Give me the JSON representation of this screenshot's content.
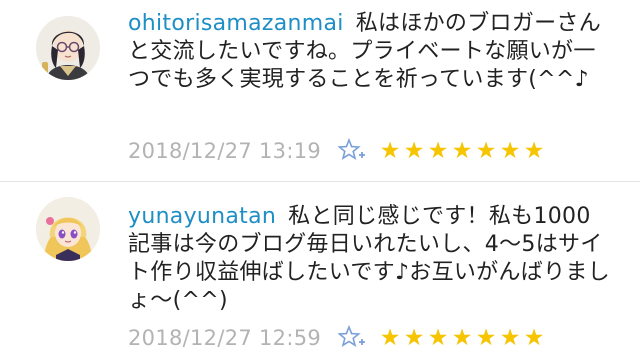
{
  "comments": [
    {
      "username": "ohitorisamazanmai",
      "text": "私はほかのブロガーさんと交流したいですね。プライベートな願いが一つでも多く実現することを祈っています(^^♪",
      "timestamp": "2018/12/27 13:19",
      "star_count": 7,
      "avatar_icon": "avatar-woman-glasses"
    },
    {
      "username": "yunayunatan",
      "text": "私と同じ感じです！私も1000記事は今のブログ毎日いれたいし、4〜5はサイト作り収益伸ばしたいです♪お互いがんばりましょ〜(^^)",
      "timestamp": "2018/12/27 12:59",
      "star_count": 7,
      "avatar_icon": "avatar-anime-girl"
    }
  ],
  "icons": {
    "add_star": "star-plus-icon",
    "star": "★"
  },
  "colors": {
    "username": "#1e8ec6",
    "timestamp": "#b3b3b3",
    "star": "#f6c400",
    "add_star": "#7aa0d8"
  }
}
